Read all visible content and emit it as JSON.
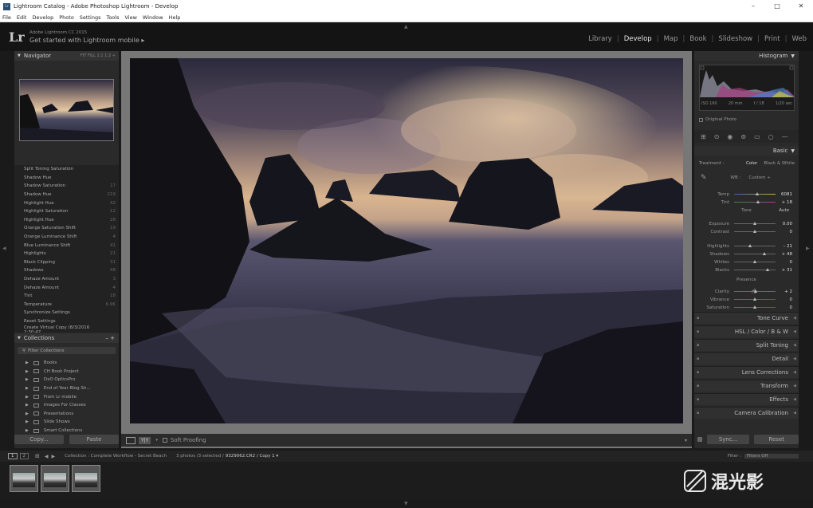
{
  "window": {
    "title": "Lightroom Catalog - Adobe Photoshop Lightroom - Develop",
    "icon_text": "Lr",
    "controls": [
      "–",
      "□",
      "✕"
    ]
  },
  "menu": [
    "File",
    "Edit",
    "Develop",
    "Photo",
    "Settings",
    "Tools",
    "View",
    "Window",
    "Help"
  ],
  "identity": {
    "logo": "Lr",
    "line1": "Adobe Lightroom CC 2015",
    "line2": "Get started with Lightroom mobile ▸"
  },
  "modules": [
    "Library",
    "Develop",
    "Map",
    "Book",
    "Slideshow",
    "Print",
    "Web"
  ],
  "active_module": "Develop",
  "navigator": {
    "title": "Navigator",
    "options": "FIT  FILL  1:1  1:2 ÷"
  },
  "history": [
    {
      "label": "Split Toning Saturation",
      "v1": "",
      "v2": ""
    },
    {
      "label": "Shadow Hue",
      "v1": "",
      "v2": ""
    },
    {
      "label": "Shadow Saturation",
      "v1": "",
      "v2": "17"
    },
    {
      "label": "Shadow Hue",
      "v1": "",
      "v2": "219"
    },
    {
      "label": "Highlight Hue",
      "v1": "",
      "v2": "42"
    },
    {
      "label": "Highlight Saturation",
      "v1": "",
      "v2": "12"
    },
    {
      "label": "Highlight Hue",
      "v1": "",
      "v2": "26"
    },
    {
      "label": "Orange Saturation Shift",
      "v1": "",
      "v2": "19"
    },
    {
      "label": "Orange Luminance Shift",
      "v1": "",
      "v2": "4"
    },
    {
      "label": "Blue Luminance Shift",
      "v1": "",
      "v2": "41"
    },
    {
      "label": "Highlights",
      "v1": "",
      "v2": "21"
    },
    {
      "label": "Black Clipping",
      "v1": "",
      "v2": "31"
    },
    {
      "label": "Shadows",
      "v1": "",
      "v2": "48"
    },
    {
      "label": "Dehaze Amount",
      "v1": "",
      "v2": "3"
    },
    {
      "label": "Dehaze Amount",
      "v1": "",
      "v2": "4"
    },
    {
      "label": "Tint",
      "v1": "",
      "v2": "18"
    },
    {
      "label": "Temperature",
      "v1": "",
      "v2": "6.9K"
    },
    {
      "label": "Synchronize Settings",
      "v1": "",
      "v2": ""
    },
    {
      "label": "Reset Settings",
      "v1": "",
      "v2": ""
    },
    {
      "label": "Create Virtual Copy (8/3/2016 2:30:47 ...",
      "v1": "",
      "v2": ""
    }
  ],
  "collections": {
    "title": "Collections",
    "filter": "Filter Collections",
    "items": [
      "Books",
      "CH Book Project",
      "DxO OpticsPro",
      "End of Year Blog Sh...",
      "From Lr mobile",
      "Images For Classes",
      "Presentations",
      "Slide Shows",
      "Smart Collections"
    ]
  },
  "left_buttons": {
    "copy": "Copy...",
    "paste": "Paste"
  },
  "toolbar": {
    "yy": "Y|Y",
    "soft_proofing": "Soft Proofing"
  },
  "histogram": {
    "title": "Histogram",
    "readout": [
      "ISO 160",
      "20 mm",
      "f / 18",
      "1/20 sec"
    ],
    "original_photo": "Original Photo"
  },
  "basic": {
    "title": "Basic",
    "treatment_label": "Treatment :",
    "treatment_color": "Color",
    "treatment_bw": "Black & White",
    "wb_label": "WB :",
    "wb_value": "Custom ÷",
    "temp": {
      "label": "Temp",
      "value": "6081"
    },
    "tint": {
      "label": "Tint",
      "value": "+ 18"
    },
    "tone_label": "Tone",
    "auto": "Auto",
    "exposure": {
      "label": "Exposure",
      "value": "0.00"
    },
    "contrast": {
      "label": "Contrast",
      "value": "0"
    },
    "highlights": {
      "label": "Highlights",
      "value": "– 21"
    },
    "shadows": {
      "label": "Shadows",
      "value": "+ 48"
    },
    "whites": {
      "label": "Whites",
      "value": "0"
    },
    "blacks": {
      "label": "Blacks",
      "value": "+ 31"
    },
    "presence_label": "Presence",
    "clarity": {
      "label": "Clarity",
      "value": "+ 2"
    },
    "vibrance": {
      "label": "Vibrance",
      "value": "0"
    },
    "saturation": {
      "label": "Saturation",
      "value": "0"
    }
  },
  "sections": [
    "Tone Curve",
    "HSL / Color / B & W",
    "Split Toning",
    "Detail",
    "Lens Corrections",
    "Transform",
    "Effects",
    "Camera Calibration"
  ],
  "right_buttons": {
    "sync": "Sync...",
    "reset": "Reset"
  },
  "filmbar": {
    "pages": [
      "1",
      "2"
    ],
    "source": "Collection : Complete Workflow - Secret Beach",
    "count": "3 photos /3 selected /",
    "file": "9329062.CR2 / Copy 1 ▾",
    "filter_label": "Filter :",
    "filter_value": "Filters Off"
  },
  "watermark": "混光影",
  "colors": {
    "accent": "#e6e6e6",
    "panel": "#2a2a2a",
    "background": "#1a1a1a"
  }
}
